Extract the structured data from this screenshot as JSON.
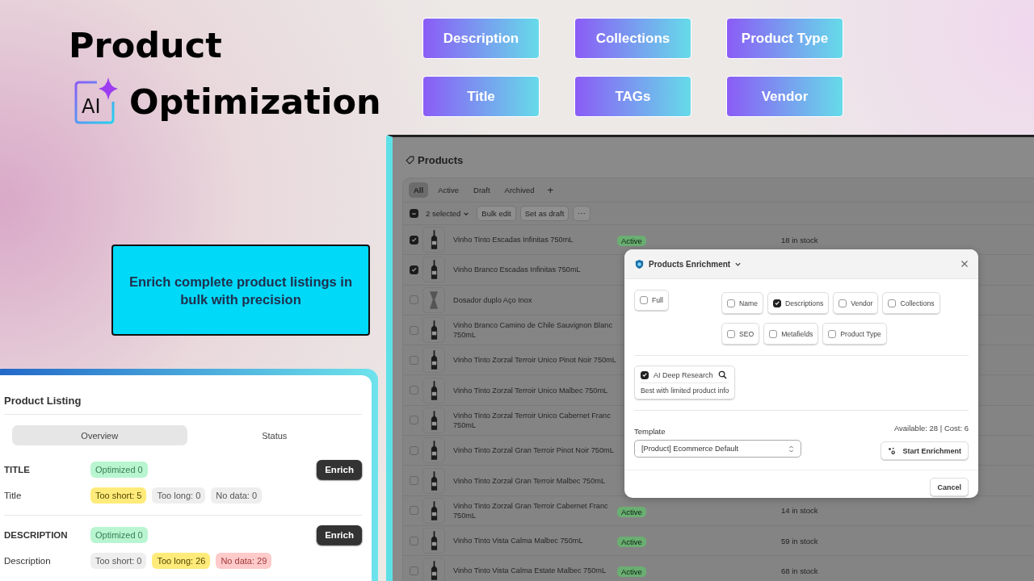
{
  "headline": {
    "line_1": "Product",
    "logo_text": "AI",
    "line_2": "Optimization"
  },
  "feature_tags": [
    "Description",
    "Collections",
    "Product Type",
    "Title",
    "TAGs",
    "Vendor"
  ],
  "callout": "Enrich complete product listings in bulk with precision",
  "product_listing": {
    "title": "Product Listing",
    "tabs": [
      {
        "label": "Overview",
        "selected": true
      },
      {
        "label": "Status",
        "selected": false
      }
    ],
    "sections": [
      {
        "heading": "TITLE",
        "optimized": "Optimized 0",
        "button": "Enrich",
        "field": "Title",
        "metrics": [
          {
            "text": "Too short: 5",
            "kind": "warning"
          },
          {
            "text": "Too long: 0",
            "kind": "neutral"
          },
          {
            "text": "No data: 0",
            "kind": "neutral"
          }
        ]
      },
      {
        "heading": "DESCRIPTION",
        "optimized": "Optimized 0",
        "button": "Enrich",
        "field": "Description",
        "metrics": [
          {
            "text": "Too short: 0",
            "kind": "neutral"
          },
          {
            "text": "Too long: 26",
            "kind": "warning"
          },
          {
            "text": "No data: 29",
            "kind": "critical"
          }
        ]
      }
    ]
  },
  "products": {
    "title": "Products",
    "tabs": [
      {
        "label": "All",
        "selected": true
      },
      {
        "label": "Active",
        "selected": false
      },
      {
        "label": "Draft",
        "selected": false
      },
      {
        "label": "Archived",
        "selected": false
      }
    ],
    "add_tab": "+",
    "bulk": {
      "indeterminate": true,
      "selected_count": "2 selected",
      "actions": [
        "Bulk edit",
        "Set as draft"
      ],
      "more": "⋯"
    },
    "rows": [
      {
        "name": "Vinho Tinto Escadas Infinitas 750mL",
        "kind": "bottle",
        "checked": true,
        "status": "Active",
        "stock": "18 in stock"
      },
      {
        "name": "Vinho Branco Escadas Infinitas 750mL",
        "kind": "bottle",
        "checked": true
      },
      {
        "name": "Dosador duplo Aço Inox",
        "kind": "jigger",
        "checked": false
      },
      {
        "name": "Vinho Branco Camino de Chile Sauvignon Blanc 750mL",
        "kind": "bottle",
        "checked": false
      },
      {
        "name": "Vinho Tinto Zorzal Terroir Unico Pinot Noir 750mL",
        "kind": "bottle",
        "checked": false
      },
      {
        "name": "Vinho Tinto Zorzal Terroir Unico Malbec 750mL",
        "kind": "bottle",
        "checked": false
      },
      {
        "name": "Vinho Tinto Zorzal Terroir Unico Cabernet Franc 750mL",
        "kind": "bottle",
        "checked": false
      },
      {
        "name": "Vinho Tinto Zorzal Gran Terroir Pinot Noir 750mL",
        "kind": "bottle",
        "checked": false
      },
      {
        "name": "Vinho Tinto Zorzal Gran Terroir Malbec 750mL",
        "kind": "bottle",
        "checked": false
      },
      {
        "name": "Vinho Tinto Zorzal Gran Terroir Cabernet Franc 750mL",
        "kind": "bottle",
        "checked": false,
        "status": "Active",
        "stock": "14 in stock"
      },
      {
        "name": "Vinho Tinto Vista Calma Malbec 750mL",
        "kind": "bottle",
        "checked": false,
        "status": "Active",
        "stock": "59 in stock"
      },
      {
        "name": "Vinho Tinto Vista Calma Estate Malbec 750mL",
        "kind": "bottle",
        "checked": false,
        "status": "Active",
        "stock": "68 in stock"
      }
    ]
  },
  "enrichment_dialog": {
    "title": "Products Enrichment",
    "full": {
      "label": "Full",
      "checked": false
    },
    "fields": [
      {
        "label": "Name",
        "checked": false
      },
      {
        "label": "Descriptions",
        "checked": true
      },
      {
        "label": "Vendor",
        "checked": false
      },
      {
        "label": "Collections",
        "checked": false
      },
      {
        "label": "SEO",
        "checked": false
      },
      {
        "label": "Metafields",
        "checked": false
      },
      {
        "label": "Product Type",
        "checked": false
      }
    ],
    "deep_research": {
      "label": "AI Deep Research",
      "checked": true,
      "hint": "Best with limited product info"
    },
    "template_label": "Template",
    "template_value": "[Product] Ecommerce Default",
    "availability": "Available: 28 | Cost: 6",
    "start_button": "Start Enrichment",
    "cancel_button": "Cancel"
  }
}
